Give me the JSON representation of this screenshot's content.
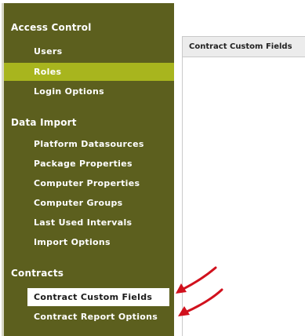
{
  "sidebar": {
    "sections": [
      {
        "title": "Access Control",
        "items": [
          {
            "label": "Users"
          },
          {
            "label": "Roles",
            "state": "active"
          },
          {
            "label": "Login Options"
          }
        ]
      },
      {
        "title": "Data Import",
        "items": [
          {
            "label": "Platform Datasources"
          },
          {
            "label": "Package Properties"
          },
          {
            "label": "Computer Properties"
          },
          {
            "label": "Computer Groups"
          },
          {
            "label": "Last Used Intervals"
          },
          {
            "label": "Import Options"
          }
        ]
      },
      {
        "title": "Contracts",
        "items": [
          {
            "label": "Contract Custom Fields",
            "state": "highlighted"
          },
          {
            "label": "Contract Report Options"
          }
        ]
      }
    ]
  },
  "main": {
    "header_title": "Contract Custom Fields"
  },
  "colors": {
    "sidebar_bg": "#5c5f1e",
    "active_item_bg": "#a8b51e",
    "arrow": "#d1111d"
  }
}
